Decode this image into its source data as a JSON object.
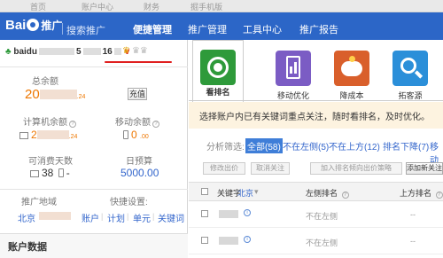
{
  "topbar": {
    "links": [
      "首页",
      "账户中心",
      "财务",
      "掘手机版"
    ]
  },
  "header": {
    "logo_text": "Bai",
    "logo_text2": "推广",
    "subtitle": "搜索推广",
    "nav": [
      "便捷管理",
      "推广管理",
      "工具中心",
      "推广报告"
    ],
    "active_index": 0,
    "bg_color": "#2c66c7"
  },
  "account": {
    "name_prefix": "baidu",
    "name_mid": "5",
    "name_suffix": "16",
    "level": "v",
    "crowns": [
      "♛",
      "♛♛"
    ],
    "total_balance_label": "总余额",
    "total_balance": "20",
    "total_balance_cents": ".24",
    "recharge_button": "充值",
    "pc_balance_label": "计算机余额",
    "pc_balance": "2",
    "pc_balance_cents": ".24",
    "mobile_balance_label": "移动余额",
    "mobile_balance": "0",
    "mobile_balance_cents": ".00",
    "days_label": "可消费天数",
    "days_value": "38",
    "days_dash": "-",
    "daily_budget_label": "日预算",
    "daily_budget": "5000",
    "daily_budget_cents": ".00",
    "region_label": "推广地域",
    "region_value": "北京",
    "quick_settings_label": "快捷设置:",
    "quick_links": [
      "账户",
      "计划",
      "单元",
      "关键词"
    ],
    "account_data_label": "账户数据"
  },
  "tools": [
    {
      "label": "看排名",
      "icon": "target-icon",
      "color": "#2e9a3a"
    },
    {
      "label": "移动优化",
      "icon": "mobile-chart-icon",
      "color": "#7b5cc4"
    },
    {
      "label": "降成本",
      "icon": "piggy-bank-icon",
      "color": "#d95f2b"
    },
    {
      "label": "拓客源",
      "icon": "magnifier-icon",
      "color": "#2b8fd9"
    }
  ],
  "tip": "选择账户内已有关键词重点关注，随时看排名，及时优化。",
  "filters": {
    "label": "分析筛选:",
    "options": [
      "全部(58)",
      "不在左侧(5)",
      "不在上方(12)",
      "排名下降(7)",
      "移动"
    ],
    "selected_index": 0
  },
  "ops": [
    "修改出价",
    "取消关注",
    "加入排名倾向出价策略",
    "添加新关注"
  ],
  "table": {
    "headers": [
      "关键字",
      "北京",
      "左侧排名",
      "上方排名"
    ],
    "rows": [
      {
        "left": "不在左侧",
        "top": "--"
      },
      {
        "left": "不在左侧",
        "top": "--"
      }
    ]
  }
}
